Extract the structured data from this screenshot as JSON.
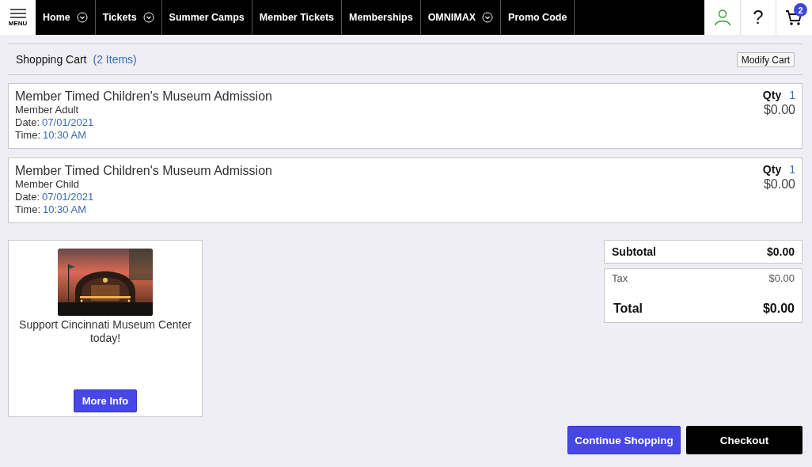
{
  "nav": {
    "menu_label": "MENU",
    "items": [
      {
        "label": "Home",
        "dropdown": true
      },
      {
        "label": "Tickets",
        "dropdown": true
      },
      {
        "label": "Summer Camps",
        "dropdown": false
      },
      {
        "label": "Member Tickets",
        "dropdown": false
      },
      {
        "label": "Memberships",
        "dropdown": false
      },
      {
        "label": "OMNIMAX",
        "dropdown": true
      },
      {
        "label": "Promo Code",
        "dropdown": false
      }
    ],
    "help_label": "?",
    "cart_count": "2"
  },
  "cart": {
    "title": "Shopping Cart",
    "count": "(2 Items)",
    "modify_button": "Modify Cart"
  },
  "items": [
    {
      "name": "Member Timed Children's Museum Admission",
      "type": "Member Adult",
      "date_label": "Date:",
      "date": "07/01/2021",
      "time_label": "Time:",
      "time": "10:30 AM",
      "qty_label": "Qty",
      "qty": "1",
      "price": "$0.00"
    },
    {
      "name": "Member Timed Children's Museum Admission",
      "type": "Member Child",
      "date_label": "Date:",
      "date": "07/01/2021",
      "time_label": "Time:",
      "time": "10:30 AM",
      "qty_label": "Qty",
      "qty": "1",
      "price": "$0.00"
    }
  ],
  "promo": {
    "text": "Support Cincinnati Museum Center today!",
    "button": "More Info"
  },
  "summary": {
    "subtotal_label": "Subtotal",
    "subtotal": "$0.00",
    "tax_label": "Tax",
    "tax": "$0.00",
    "total_label": "Total",
    "total": "$0.00"
  },
  "actions": {
    "continue": "Continue Shopping",
    "checkout": "Checkout"
  }
}
